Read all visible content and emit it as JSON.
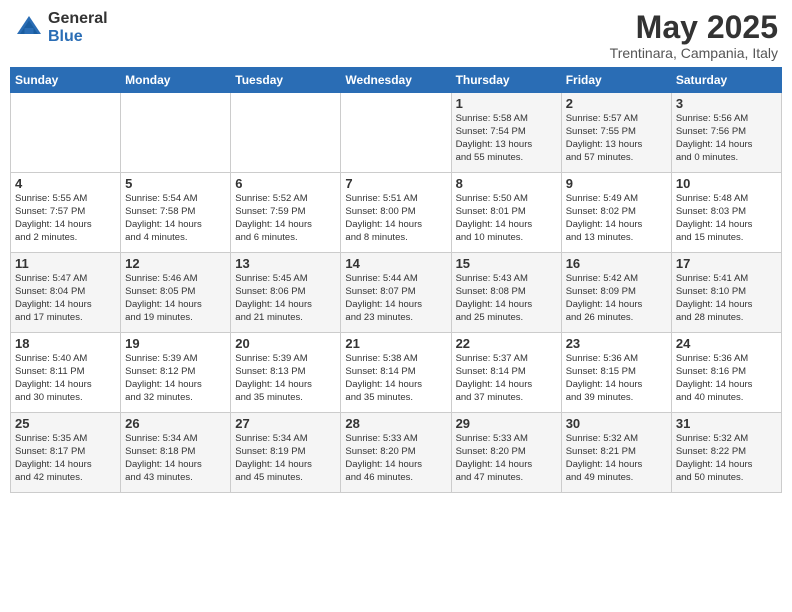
{
  "header": {
    "logo_general": "General",
    "logo_blue": "Blue",
    "title": "May 2025",
    "location": "Trentinara, Campania, Italy"
  },
  "days_of_week": [
    "Sunday",
    "Monday",
    "Tuesday",
    "Wednesday",
    "Thursday",
    "Friday",
    "Saturday"
  ],
  "weeks": [
    [
      {
        "day": "",
        "info": ""
      },
      {
        "day": "",
        "info": ""
      },
      {
        "day": "",
        "info": ""
      },
      {
        "day": "",
        "info": ""
      },
      {
        "day": "1",
        "info": "Sunrise: 5:58 AM\nSunset: 7:54 PM\nDaylight: 13 hours\nand 55 minutes."
      },
      {
        "day": "2",
        "info": "Sunrise: 5:57 AM\nSunset: 7:55 PM\nDaylight: 13 hours\nand 57 minutes."
      },
      {
        "day": "3",
        "info": "Sunrise: 5:56 AM\nSunset: 7:56 PM\nDaylight: 14 hours\nand 0 minutes."
      }
    ],
    [
      {
        "day": "4",
        "info": "Sunrise: 5:55 AM\nSunset: 7:57 PM\nDaylight: 14 hours\nand 2 minutes."
      },
      {
        "day": "5",
        "info": "Sunrise: 5:54 AM\nSunset: 7:58 PM\nDaylight: 14 hours\nand 4 minutes."
      },
      {
        "day": "6",
        "info": "Sunrise: 5:52 AM\nSunset: 7:59 PM\nDaylight: 14 hours\nand 6 minutes."
      },
      {
        "day": "7",
        "info": "Sunrise: 5:51 AM\nSunset: 8:00 PM\nDaylight: 14 hours\nand 8 minutes."
      },
      {
        "day": "8",
        "info": "Sunrise: 5:50 AM\nSunset: 8:01 PM\nDaylight: 14 hours\nand 10 minutes."
      },
      {
        "day": "9",
        "info": "Sunrise: 5:49 AM\nSunset: 8:02 PM\nDaylight: 14 hours\nand 13 minutes."
      },
      {
        "day": "10",
        "info": "Sunrise: 5:48 AM\nSunset: 8:03 PM\nDaylight: 14 hours\nand 15 minutes."
      }
    ],
    [
      {
        "day": "11",
        "info": "Sunrise: 5:47 AM\nSunset: 8:04 PM\nDaylight: 14 hours\nand 17 minutes."
      },
      {
        "day": "12",
        "info": "Sunrise: 5:46 AM\nSunset: 8:05 PM\nDaylight: 14 hours\nand 19 minutes."
      },
      {
        "day": "13",
        "info": "Sunrise: 5:45 AM\nSunset: 8:06 PM\nDaylight: 14 hours\nand 21 minutes."
      },
      {
        "day": "14",
        "info": "Sunrise: 5:44 AM\nSunset: 8:07 PM\nDaylight: 14 hours\nand 23 minutes."
      },
      {
        "day": "15",
        "info": "Sunrise: 5:43 AM\nSunset: 8:08 PM\nDaylight: 14 hours\nand 25 minutes."
      },
      {
        "day": "16",
        "info": "Sunrise: 5:42 AM\nSunset: 8:09 PM\nDaylight: 14 hours\nand 26 minutes."
      },
      {
        "day": "17",
        "info": "Sunrise: 5:41 AM\nSunset: 8:10 PM\nDaylight: 14 hours\nand 28 minutes."
      }
    ],
    [
      {
        "day": "18",
        "info": "Sunrise: 5:40 AM\nSunset: 8:11 PM\nDaylight: 14 hours\nand 30 minutes."
      },
      {
        "day": "19",
        "info": "Sunrise: 5:39 AM\nSunset: 8:12 PM\nDaylight: 14 hours\nand 32 minutes."
      },
      {
        "day": "20",
        "info": "Sunrise: 5:39 AM\nSunset: 8:13 PM\nDaylight: 14 hours\nand 35 minutes."
      },
      {
        "day": "21",
        "info": "Sunrise: 5:38 AM\nSunset: 8:14 PM\nDaylight: 14 hours\nand 35 minutes."
      },
      {
        "day": "22",
        "info": "Sunrise: 5:37 AM\nSunset: 8:14 PM\nDaylight: 14 hours\nand 37 minutes."
      },
      {
        "day": "23",
        "info": "Sunrise: 5:36 AM\nSunset: 8:15 PM\nDaylight: 14 hours\nand 39 minutes."
      },
      {
        "day": "24",
        "info": "Sunrise: 5:36 AM\nSunset: 8:16 PM\nDaylight: 14 hours\nand 40 minutes."
      }
    ],
    [
      {
        "day": "25",
        "info": "Sunrise: 5:35 AM\nSunset: 8:17 PM\nDaylight: 14 hours\nand 42 minutes."
      },
      {
        "day": "26",
        "info": "Sunrise: 5:34 AM\nSunset: 8:18 PM\nDaylight: 14 hours\nand 43 minutes."
      },
      {
        "day": "27",
        "info": "Sunrise: 5:34 AM\nSunset: 8:19 PM\nDaylight: 14 hours\nand 45 minutes."
      },
      {
        "day": "28",
        "info": "Sunrise: 5:33 AM\nSunset: 8:20 PM\nDaylight: 14 hours\nand 46 minutes."
      },
      {
        "day": "29",
        "info": "Sunrise: 5:33 AM\nSunset: 8:20 PM\nDaylight: 14 hours\nand 47 minutes."
      },
      {
        "day": "30",
        "info": "Sunrise: 5:32 AM\nSunset: 8:21 PM\nDaylight: 14 hours\nand 49 minutes."
      },
      {
        "day": "31",
        "info": "Sunrise: 5:32 AM\nSunset: 8:22 PM\nDaylight: 14 hours\nand 50 minutes."
      }
    ]
  ]
}
